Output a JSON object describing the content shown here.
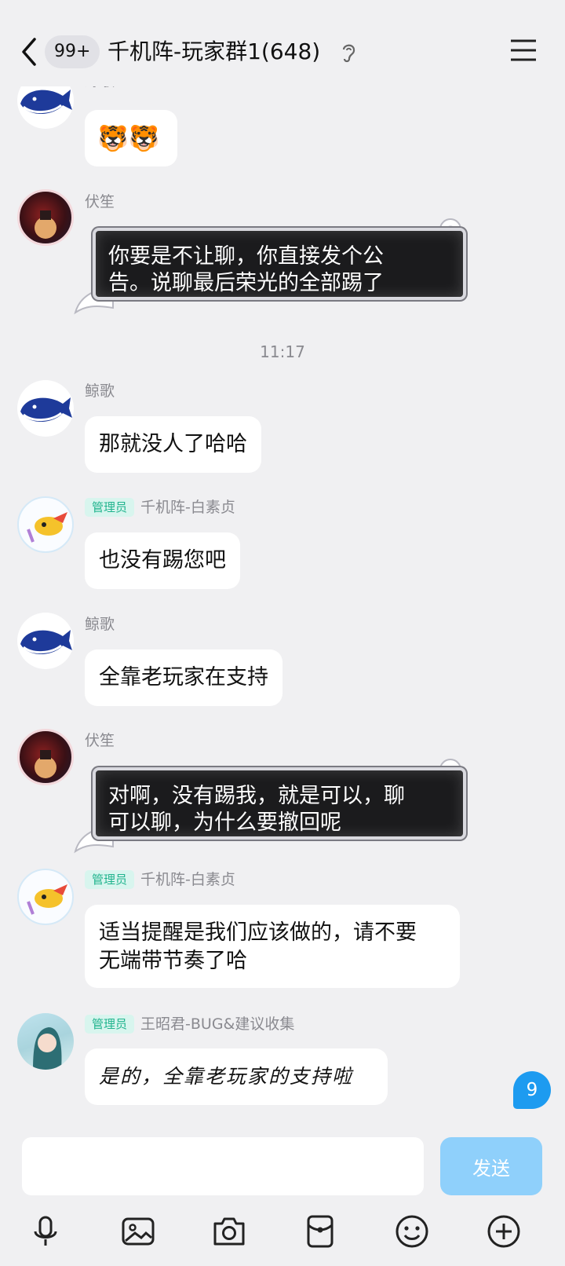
{
  "header": {
    "unread_count": "99+",
    "title": "千机阵-玩家群1(648)"
  },
  "messages": [
    {
      "sender": "鲸歌",
      "text": "🐯🐯"
    },
    {
      "sender": "伏笙",
      "text_line1": "你要是不让聊，你直接发个公",
      "text_line2": "告。说聊最后荣光的全部踢了"
    },
    {
      "sender": "鲸歌",
      "text": "那就没人了哈哈"
    },
    {
      "tag": "管理员",
      "sender": "千机阵-白素贞",
      "text": "也没有踢您吧"
    },
    {
      "sender": "鲸歌",
      "text": "全靠老玩家在支持"
    },
    {
      "sender": "伏笙",
      "text_line1": "对啊，没有踢我，就是可以，聊",
      "text_line2": "可以聊，为什么要撤回呢"
    },
    {
      "tag": "管理员",
      "sender": "千机阵-白素贞",
      "text_line1": "适当提醒是我们应该做的，请不要",
      "text_line2": "无端带节奏了哈"
    },
    {
      "tag": "管理员",
      "sender": "王昭君-BUG&建议收集",
      "text": "是的，全靠老玩家的支持啦"
    }
  ],
  "timestamp": "11:17",
  "new_message_badge": "9",
  "input": {
    "placeholder": "",
    "send_label": "发送"
  },
  "toolbar": {
    "icons": [
      "microphone-icon",
      "image-icon",
      "camera-icon",
      "red-packet-icon",
      "emoji-icon",
      "plus-icon"
    ]
  },
  "colors": {
    "background": "#f0f0f2",
    "admin_tag": "#21b48e",
    "send_button": "#8fd0fb",
    "unread_badge": "#1d9bf0"
  }
}
